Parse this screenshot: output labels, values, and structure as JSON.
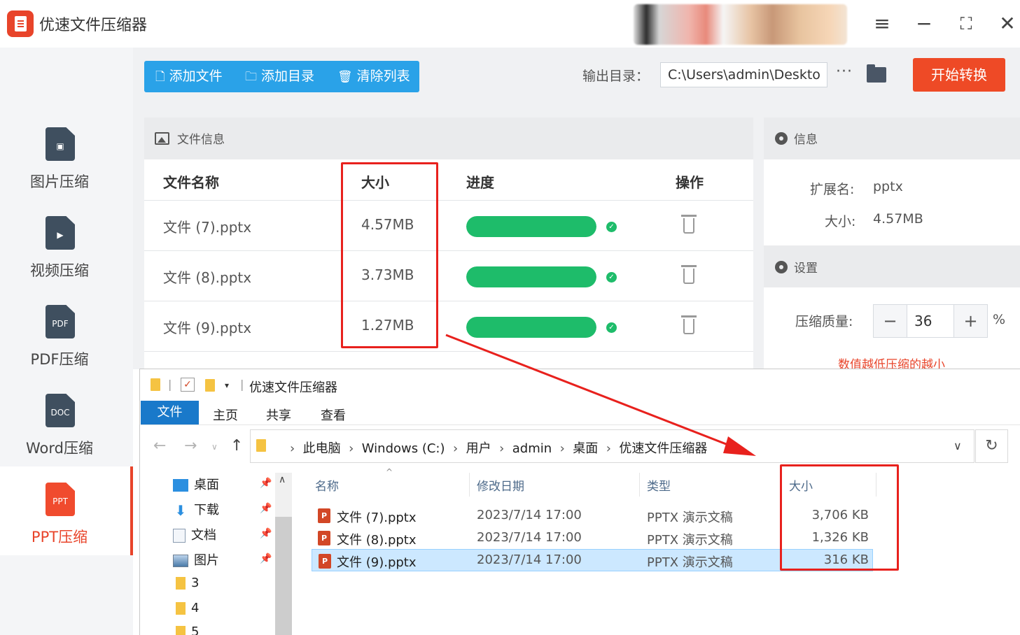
{
  "app": {
    "title": "优速文件压缩器",
    "accent": "#e8442a",
    "toolbar_blue": "#2aa2e8"
  },
  "sidebar": {
    "items": [
      {
        "label": "图片压缩",
        "glyph": "▣",
        "icon": "image-file-icon"
      },
      {
        "label": "视频压缩",
        "glyph": "▶",
        "icon": "video-file-icon"
      },
      {
        "label": "PDF压缩",
        "glyph": "PDF",
        "icon": "pdf-file-icon"
      },
      {
        "label": "Word压缩",
        "glyph": "DOC",
        "icon": "doc-file-icon"
      },
      {
        "label": "PPT压缩",
        "glyph": "PPT",
        "icon": "ppt-file-icon",
        "active": true
      }
    ]
  },
  "toolbar": {
    "add_file": "添加文件",
    "add_dir": "添加目录",
    "clear_list": "清除列表",
    "output_label": "输出目录：",
    "output_path": "C:\\Users\\admin\\Deskto",
    "more": "···",
    "start": "开始转换"
  },
  "file_panel": {
    "title": "文件信息",
    "columns": {
      "name": "文件名称",
      "size": "大小",
      "progress": "进度",
      "action": "操作"
    },
    "rows": [
      {
        "name": "文件 (7).pptx",
        "size": "4.57MB",
        "progress": 1.0
      },
      {
        "name": "文件 (8).pptx",
        "size": "3.73MB",
        "progress": 1.0
      },
      {
        "name": "文件 (9).pptx",
        "size": "1.27MB",
        "progress": 1.0
      }
    ]
  },
  "info_panel": {
    "title": "信息",
    "ext_label": "扩展名:",
    "ext_value": "pptx",
    "size_label": "大小:",
    "size_value": "4.57MB"
  },
  "settings_panel": {
    "title": "设置",
    "quality_label": "压缩质量:",
    "quality_value": "36",
    "minus": "−",
    "plus": "+",
    "unit": "%",
    "hint": "数值越低压缩的越小"
  },
  "explorer": {
    "title": "优速文件压缩器",
    "ribbon": {
      "file": "文件",
      "home": "主页",
      "share": "共享",
      "view": "查看"
    },
    "breadcrumb": [
      "此电脑",
      "Windows (C:)",
      "用户",
      "admin",
      "桌面",
      "优速文件压缩器"
    ],
    "tree": [
      {
        "label": "桌面",
        "pinned": true
      },
      {
        "label": "下载",
        "pinned": true
      },
      {
        "label": "文档",
        "pinned": true
      },
      {
        "label": "图片",
        "pinned": true
      },
      {
        "label": "3",
        "pinned": false
      },
      {
        "label": "4",
        "pinned": false
      },
      {
        "label": "5",
        "pinned": false
      }
    ],
    "columns": {
      "name": "名称",
      "modified": "修改日期",
      "type": "类型",
      "size": "大小"
    },
    "rows": [
      {
        "name": "文件 (7).pptx",
        "modified": "2023/7/14 17:00",
        "type": "PPTX 演示文稿",
        "size": "3,706 KB"
      },
      {
        "name": "文件 (8).pptx",
        "modified": "2023/7/14 17:00",
        "type": "PPTX 演示文稿",
        "size": "1,326 KB",
        "note": ""
      },
      {
        "name": "文件 (9).pptx",
        "modified": "2023/7/14 17:00",
        "type": "PPTX 演示文稿",
        "size": "316 KB",
        "selected": true
      }
    ],
    "pp_glyph": "P"
  }
}
